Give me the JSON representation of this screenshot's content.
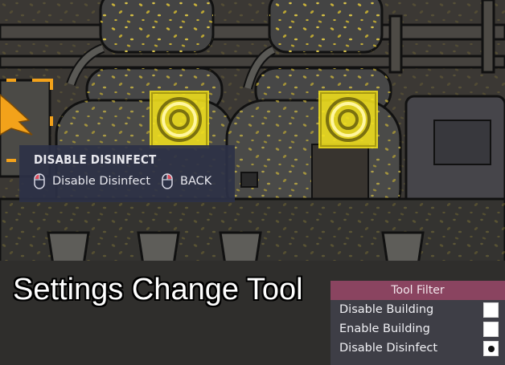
{
  "tooltip": {
    "title": "DISABLE DISINFECT",
    "primary_action": "Disable Disinfect",
    "secondary_action": "BACK",
    "primary_mouse_icon": "left-mouse-button-icon",
    "secondary_mouse_icon": "right-mouse-button-icon"
  },
  "caption": "Settings Change Tool",
  "tool_filter": {
    "title": "Tool Filter",
    "items": [
      {
        "label": "Disable Building",
        "selected": false
      },
      {
        "label": "Enable Building",
        "selected": false
      },
      {
        "label": "Disable Disinfect",
        "selected": true
      }
    ]
  },
  "colors": {
    "highlight_yellow": "#f2e11d",
    "cursor_orange": "#f3a21a",
    "tooltip_bg": "#2c3146",
    "filter_header": "#8a4460",
    "filter_bg": "#3e3e46"
  },
  "icons": [
    "disinfect-status-icon",
    "cursor-arrow-icon",
    "selection-bracket-icon",
    "mouse-icon"
  ]
}
